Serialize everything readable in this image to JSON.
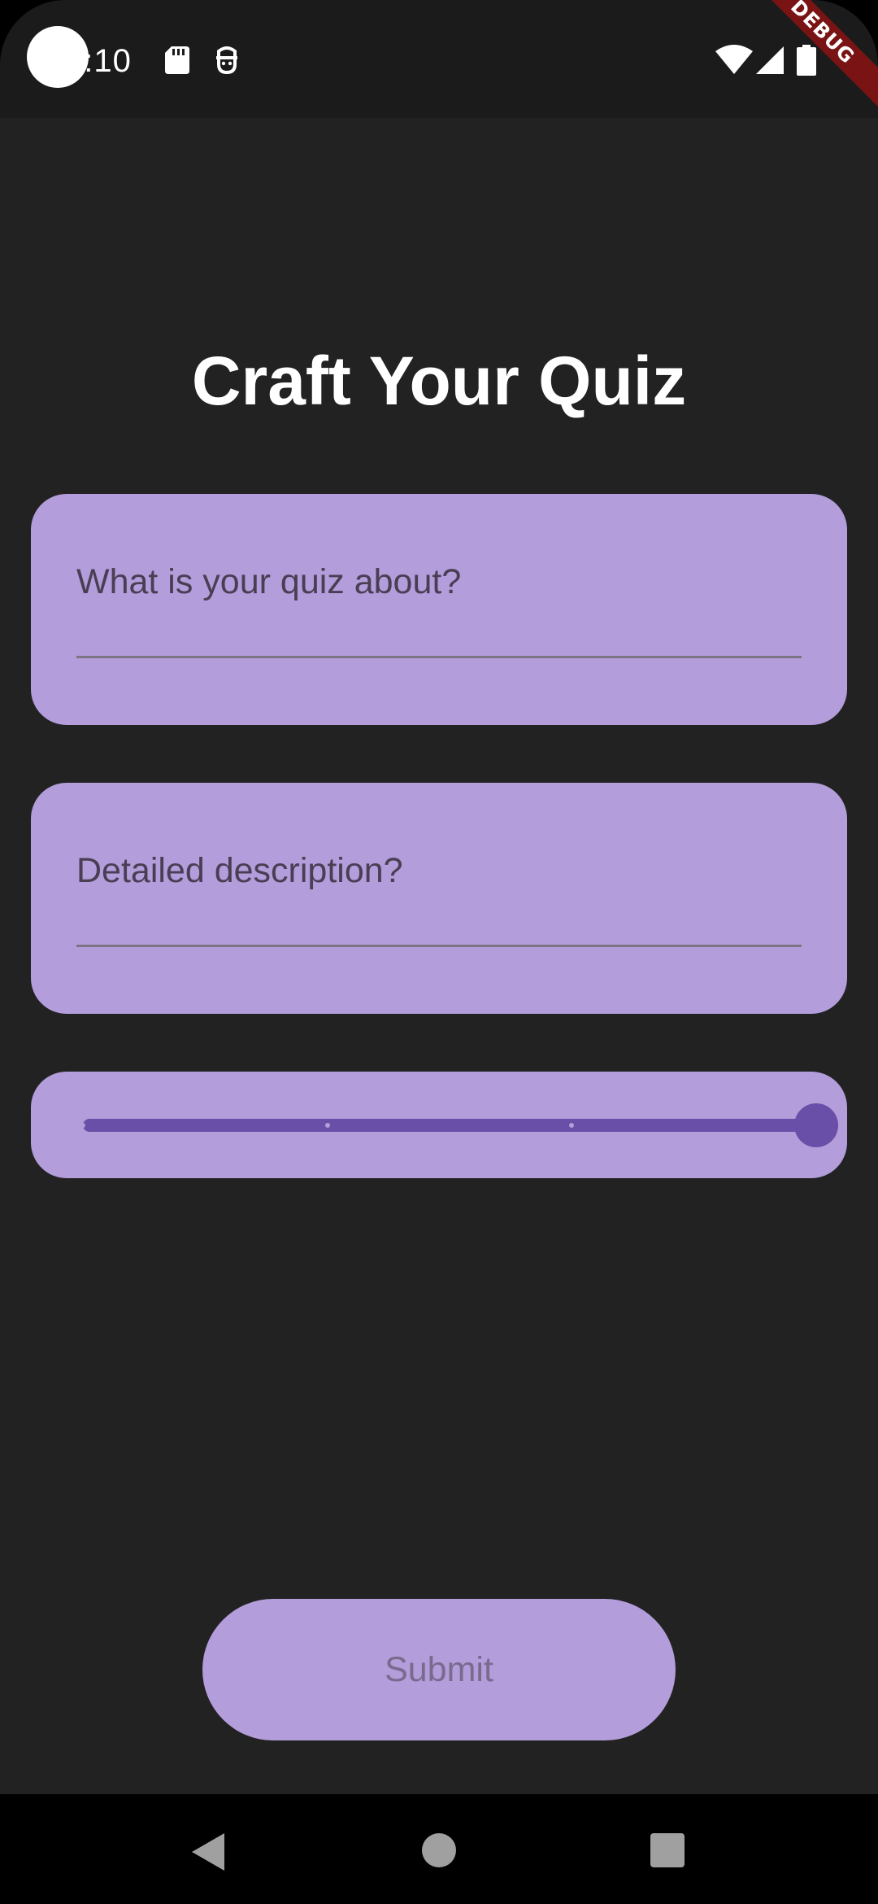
{
  "status_bar": {
    "time": "0:10",
    "icons": [
      "sd-card-icon",
      "notification-icon",
      "wifi-icon",
      "cellular-signal-icon",
      "battery-icon"
    ],
    "debug_banner": "DEBUG"
  },
  "main": {
    "title": "Craft Your Quiz",
    "topic_field": {
      "label": "What is your quiz about?",
      "value": ""
    },
    "description_field": {
      "label": "Detailed description?",
      "value": ""
    },
    "slider": {
      "min": 0,
      "max": 3,
      "value": 3,
      "divisions": 3
    },
    "submit_label": "Submit"
  },
  "nav_bar": {
    "icons": [
      "back-icon",
      "home-icon",
      "recents-icon"
    ]
  },
  "colors": {
    "background": "#222222",
    "status_bar": "#1b1b1b",
    "card": "#b39ddb",
    "accent": "#6a4fa8",
    "title": "#ffffff",
    "label": "#4a3e54",
    "submit_text": "#7a6a8e"
  }
}
